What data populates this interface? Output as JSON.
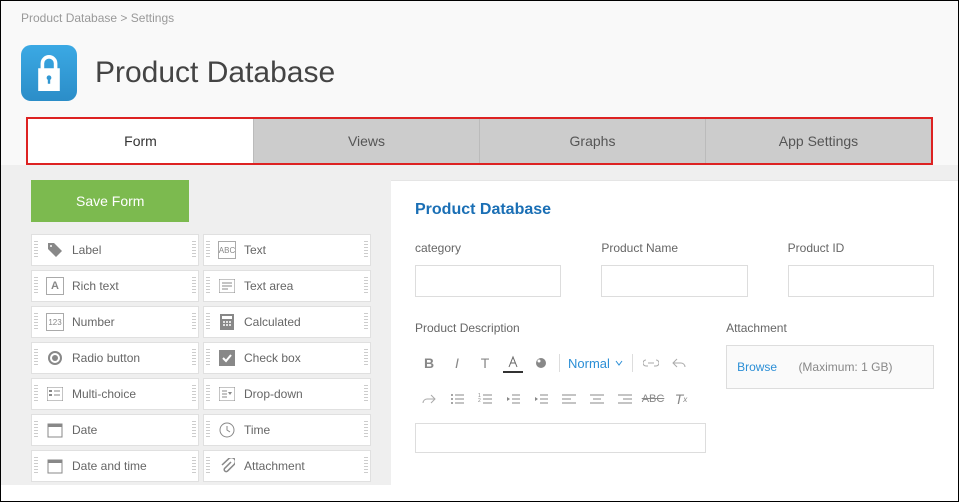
{
  "breadcrumb": {
    "root": "Product Database",
    "sep": ">",
    "current": "Settings"
  },
  "page_title": "Product Database",
  "tabs": {
    "form": "Form",
    "views": "Views",
    "graphs": "Graphs",
    "settings": "App Settings"
  },
  "save_button": "Save Form",
  "palette": {
    "label": "Label",
    "text": "Text",
    "richtext": "Rich text",
    "textarea": "Text area",
    "number": "Number",
    "calculated": "Calculated",
    "radio": "Radio button",
    "checkbox": "Check box",
    "multichoice": "Multi-choice",
    "dropdown": "Drop-down",
    "date": "Date",
    "time": "Time",
    "datetime": "Date and time",
    "attachment": "Attachment"
  },
  "form": {
    "title": "Product Database",
    "category": "category",
    "product_name": "Product Name",
    "product_id": "Product ID",
    "description": "Product Description",
    "attachment": "Attachment",
    "normal": "Normal",
    "browse": "Browse",
    "max": "(Maximum: 1 GB)"
  }
}
